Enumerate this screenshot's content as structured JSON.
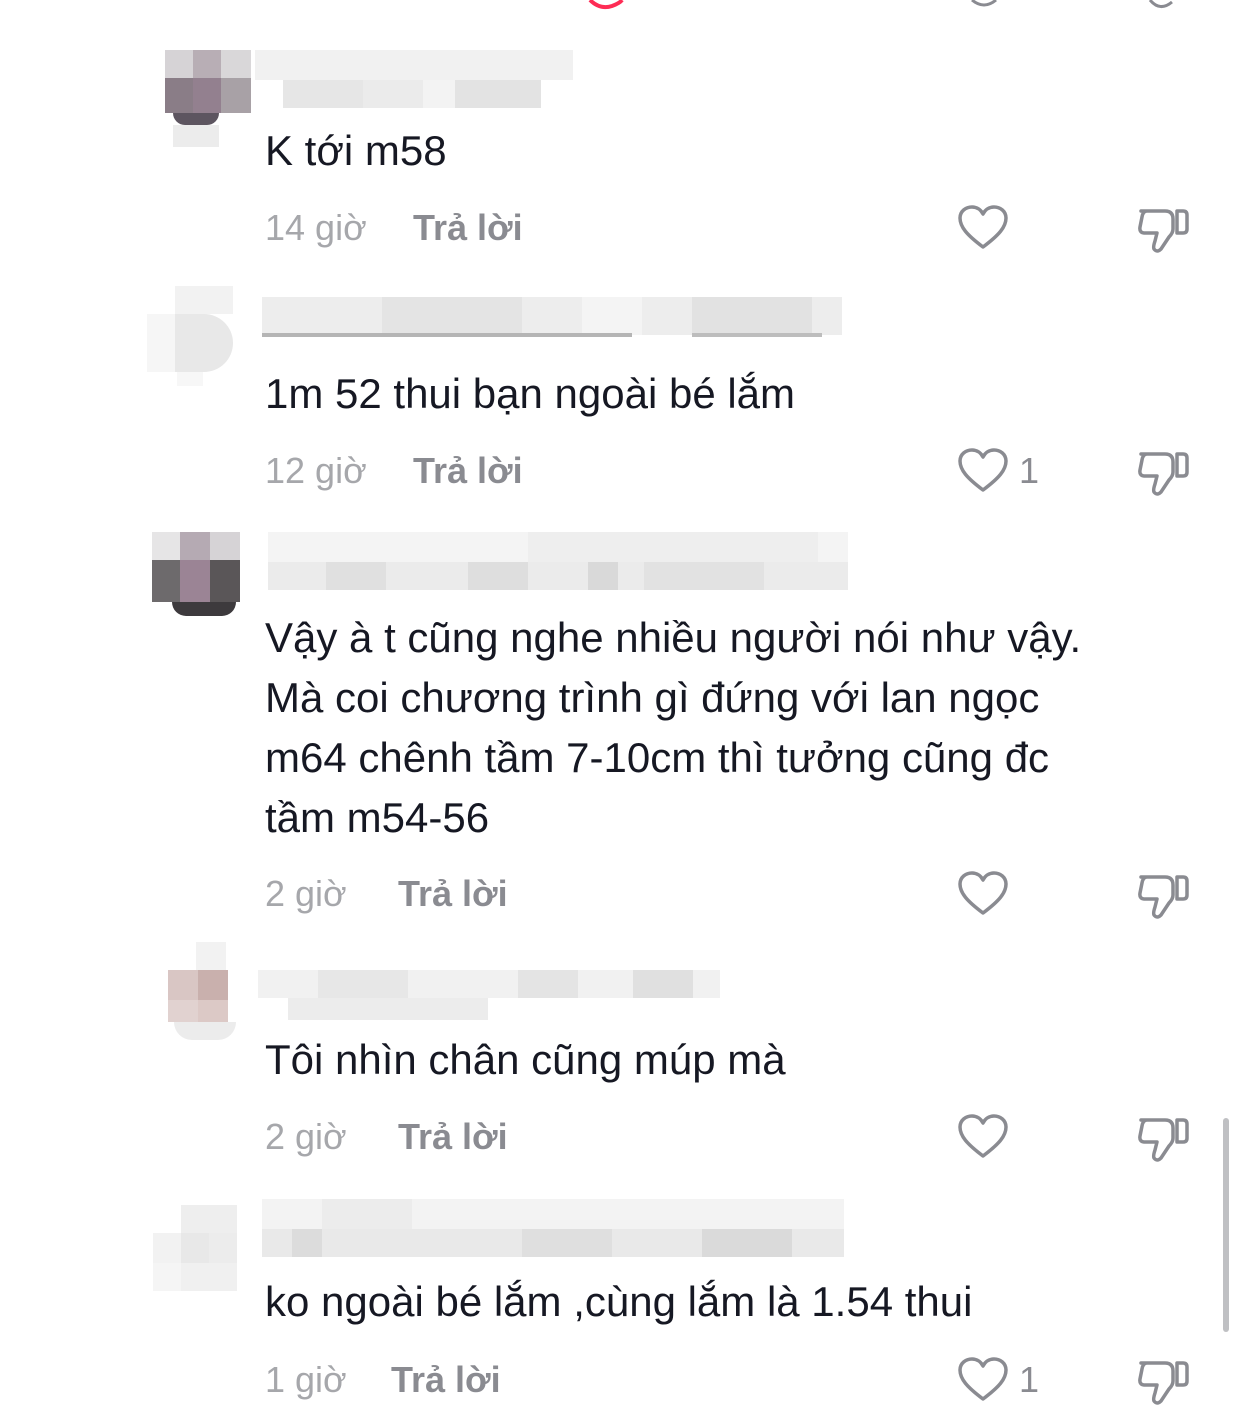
{
  "comments": [
    {
      "text": "K tới m58",
      "time": "14 giờ",
      "reply": "Trả lời",
      "likes": ""
    },
    {
      "text": "1m 52 thui bạn ngoài bé lắm",
      "time": "12 giờ",
      "reply": "Trả lời",
      "likes": "1"
    },
    {
      "text": "Vậy à t cũng nghe nhiều người nói như vậy.\nMà coi chương trình gì đứng với lan ngọc\nm64 chênh tầm 7-10cm thì tưởng cũng đc\ntầm m54-56",
      "time": "2 giờ",
      "reply": "Trả lời",
      "likes": ""
    },
    {
      "text": "Tôi nhìn chân cũng múp mà",
      "time": "2 giờ",
      "reply": "Trả lời",
      "likes": ""
    },
    {
      "text": "ko ngoài bé lắm ,cùng lắm là 1.54 thui",
      "time": "1 giờ",
      "reply": "Trả lời",
      "likes": "1"
    }
  ],
  "colors": {
    "text": "#161823",
    "meta": "#a6a7ab",
    "reply": "#8a8b91",
    "icon": "#8a8b91",
    "accent": "#fe2c55"
  },
  "icons": {
    "like": "heart-outline-icon",
    "dislike": "thumbs-down-icon"
  }
}
